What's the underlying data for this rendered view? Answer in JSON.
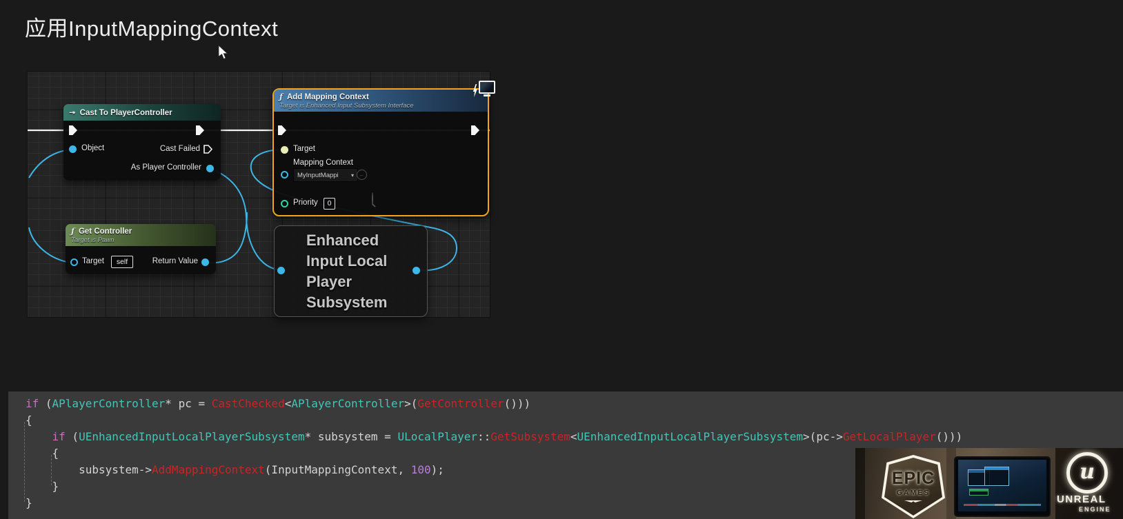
{
  "slide": {
    "title": "应用InputMappingContext"
  },
  "graph": {
    "colors": {
      "exec": "#f2f2f2",
      "data": "#3db6e8",
      "selection": "#f7a21b"
    },
    "icons": {
      "function_glyph": "ƒ",
      "cast_glyph": "↠",
      "chevron_glyph": "▾",
      "reset_glyph": "←"
    },
    "nodes": {
      "cast": {
        "title": "Cast To PlayerController",
        "pins": {
          "object": "Object",
          "cast_failed": "Cast Failed",
          "as_player_controller": "As Player Controller"
        }
      },
      "add_mapping": {
        "title": "Add Mapping Context",
        "subtitle": "Target is Enhanced Input Subsystem Interface",
        "pins": {
          "target": "Target",
          "mapping_context": "Mapping Context",
          "priority": "Priority"
        },
        "mapping_context_value": "MyInputMappi",
        "priority_value": "0"
      },
      "get_controller": {
        "title": "Get Controller",
        "subtitle": "Target is Pawn",
        "pins": {
          "target": "Target",
          "return_value": "Return Value"
        },
        "target_value": "self"
      },
      "subsystem": {
        "lines": [
          "Enhanced",
          "Input Local",
          "Player",
          "Subsystem"
        ]
      }
    }
  },
  "code": {
    "lines": [
      [
        {
          "c": "kw",
          "t": "if"
        },
        {
          "c": "pl",
          "t": " ("
        },
        {
          "c": "ty",
          "t": "APlayerController"
        },
        {
          "c": "pl",
          "t": "* pc = "
        },
        {
          "c": "fn",
          "t": "CastChecked"
        },
        {
          "c": "pl",
          "t": "<"
        },
        {
          "c": "ty",
          "t": "APlayerController"
        },
        {
          "c": "pl",
          "t": ">("
        },
        {
          "c": "fn",
          "t": "GetController"
        },
        {
          "c": "pl",
          "t": "()))"
        }
      ],
      [
        {
          "c": "pl",
          "t": "{"
        }
      ],
      [
        {
          "c": "pl",
          "t": "    "
        },
        {
          "c": "kw",
          "t": "if"
        },
        {
          "c": "pl",
          "t": " ("
        },
        {
          "c": "ty",
          "t": "UEnhancedInputLocalPlayerSubsystem"
        },
        {
          "c": "pl",
          "t": "* subsystem = "
        },
        {
          "c": "ty",
          "t": "ULocalPlayer"
        },
        {
          "c": "pl",
          "t": "::"
        },
        {
          "c": "fn",
          "t": "GetSubsystem"
        },
        {
          "c": "pl",
          "t": "<"
        },
        {
          "c": "ty",
          "t": "UEnhancedInputLocalPlayerSubsystem"
        },
        {
          "c": "pl",
          "t": ">(pc->"
        },
        {
          "c": "fn",
          "t": "GetLocalPlayer"
        },
        {
          "c": "pl",
          "t": "()))"
        }
      ],
      [
        {
          "c": "pl",
          "t": "    {"
        }
      ],
      [
        {
          "c": "pl",
          "t": "        subsystem->"
        },
        {
          "c": "fn",
          "t": "AddMappingContext"
        },
        {
          "c": "pl",
          "t": "(InputMappingContext, "
        },
        {
          "c": "num",
          "t": "100"
        },
        {
          "c": "pl",
          "t": ");"
        }
      ],
      [
        {
          "c": "pl",
          "t": "    }"
        }
      ],
      [
        {
          "c": "pl",
          "t": "}"
        }
      ]
    ]
  },
  "overlay": {
    "epic_title": "EPIC",
    "epic_subtitle": "GAMES",
    "unreal_title": "UNREAL",
    "unreal_subtitle": "ENGINE",
    "unreal_glyph": "u"
  }
}
